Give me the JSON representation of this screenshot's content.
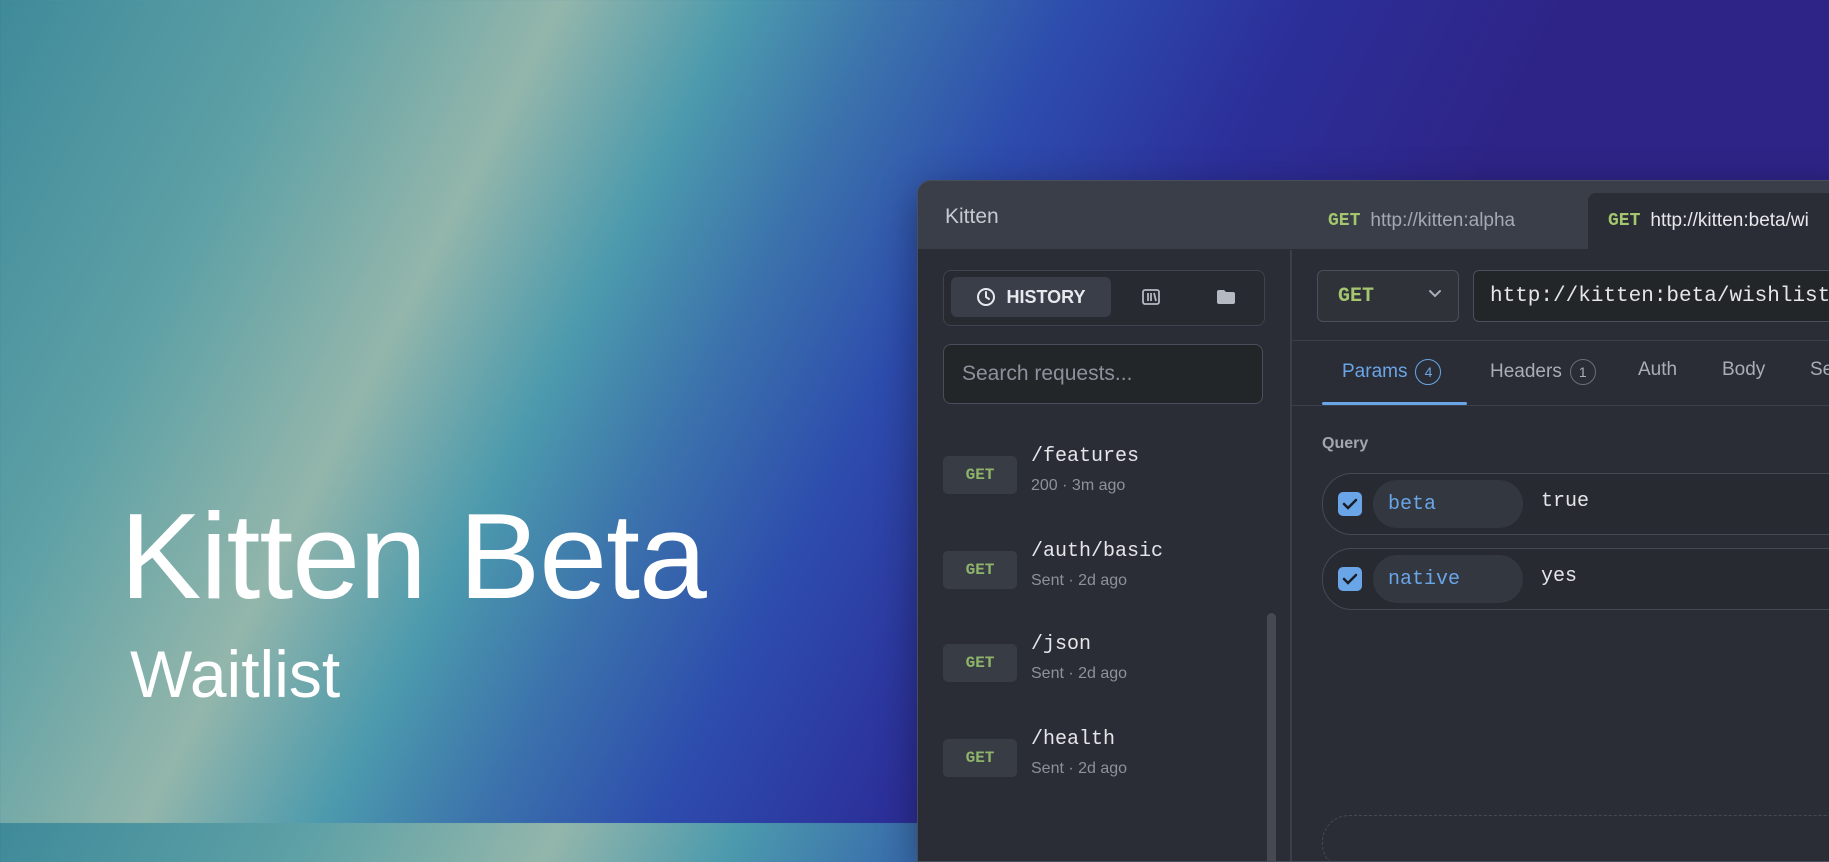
{
  "hero": {
    "title": "Kitten Beta",
    "subtitle": "Waitlist"
  },
  "app": {
    "name": "Kitten",
    "tabs": [
      {
        "method": "GET",
        "url": "http://kitten:alpha",
        "active": false
      },
      {
        "method": "GET",
        "url": "http://kitten:beta/wi",
        "active": true
      }
    ]
  },
  "sidebar": {
    "segments": {
      "history_label": "HISTORY",
      "history_icon": "clock-icon",
      "collections_icon": "library-icon",
      "folder_icon": "folder-icon"
    },
    "search": {
      "placeholder": "Search requests..."
    },
    "history": [
      {
        "method": "GET",
        "path": "/features",
        "meta": "200 · 3m ago"
      },
      {
        "method": "GET",
        "path": "/auth/basic",
        "meta": "Sent · 2d ago"
      },
      {
        "method": "GET",
        "path": "/json",
        "meta": "Sent · 2d ago"
      },
      {
        "method": "GET",
        "path": "/health",
        "meta": "Sent · 2d ago"
      }
    ]
  },
  "request": {
    "method": "GET",
    "url": "http://kitten:beta/wishlist",
    "tabs": [
      {
        "label": "Params",
        "count": "4",
        "active": true
      },
      {
        "label": "Headers",
        "count": "1",
        "active": false
      },
      {
        "label": "Auth",
        "count": "",
        "active": false
      },
      {
        "label": "Body",
        "count": "",
        "active": false
      },
      {
        "label": "Se",
        "count": "",
        "active": false
      }
    ],
    "section_label": "Query",
    "params": [
      {
        "key": "beta",
        "value": "true",
        "checked": true
      },
      {
        "key": "native",
        "value": "yes",
        "checked": true
      }
    ]
  },
  "colors": {
    "accent": "#6aa5e8",
    "method_green": "#a3c66f",
    "panel": "#2a2d35"
  }
}
